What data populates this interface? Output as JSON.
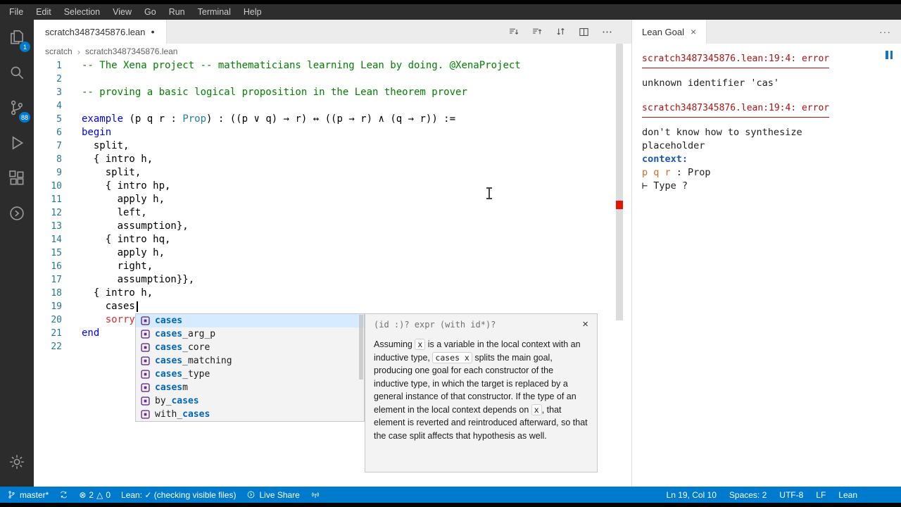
{
  "menu": {
    "items": [
      "File",
      "Edit",
      "Selection",
      "View",
      "Go",
      "Run",
      "Terminal",
      "Help"
    ]
  },
  "activity": {
    "explorer_badge": "1",
    "scm_badge": "88"
  },
  "tab": {
    "title": "scratch3487345876.lean",
    "dirty_dot": "●"
  },
  "breadcrumb": {
    "folder": "scratch",
    "sep": "›",
    "file": "scratch3487345876.lean"
  },
  "icons": {
    "close": "×",
    "more": "···"
  },
  "editor": {
    "lines": [
      {
        "num": "1",
        "text": "-- The Xena project -- mathematicians learning Lean by doing. @XenaProject"
      },
      {
        "num": "2",
        "text": ""
      },
      {
        "num": "3",
        "text": "-- proving a basic logical proposition in the Lean theorem prover"
      },
      {
        "num": "4",
        "text": ""
      },
      {
        "num": "5",
        "kw": "example",
        "mid": " (p q r : ",
        "type": "Prop",
        "rest": ") : ((p ∨ q) → r) ↔ ((p → r) ∧ (q → r)) :="
      },
      {
        "num": "6",
        "text": "begin"
      },
      {
        "num": "7",
        "text": "  split,"
      },
      {
        "num": "8",
        "text": "  { intro h,"
      },
      {
        "num": "9",
        "text": "    split,"
      },
      {
        "num": "10",
        "text": "    { intro hp,"
      },
      {
        "num": "11",
        "text": "      apply h,"
      },
      {
        "num": "12",
        "text": "      left,"
      },
      {
        "num": "13",
        "text": "      assumption},"
      },
      {
        "num": "14",
        "text": "    { intro hq,"
      },
      {
        "num": "15",
        "text": "      apply h,"
      },
      {
        "num": "16",
        "text": "      right,"
      },
      {
        "num": "17",
        "text": "      assumption}},"
      },
      {
        "num": "18",
        "text": "  { intro h,"
      },
      {
        "num": "19",
        "text": "    cases"
      },
      {
        "num": "20",
        "indent": "    ",
        "error_text": "sorry"
      },
      {
        "num": "21",
        "text": "end"
      },
      {
        "num": "22",
        "text": ""
      }
    ]
  },
  "suggest": {
    "items": [
      {
        "pre": "",
        "match": "cases",
        "post": ""
      },
      {
        "pre": "",
        "match": "cases",
        "post": "_arg_p"
      },
      {
        "pre": "",
        "match": "cases",
        "post": "_core"
      },
      {
        "pre": "",
        "match": "cases",
        "post": "_matching"
      },
      {
        "pre": "",
        "match": "cases",
        "post": "_type"
      },
      {
        "pre": "",
        "match": "cases",
        "post": "m"
      },
      {
        "pre": "by_",
        "match": "cases",
        "post": ""
      },
      {
        "pre": "with_",
        "match": "cases",
        "post": ""
      }
    ]
  },
  "docs": {
    "signature": "(id :)? expr (with id*)?",
    "p1": "Assuming ",
    "c1": "x",
    "p2": " is a variable in the local context with an inductive type, ",
    "c2": "cases x",
    "p3": " splits the main goal, producing one goal for each constructor of the inductive type, in which the target is replaced by a general instance of that constructor. If the type of an element in the local context depends on ",
    "c3": "x",
    "p4": ", that element is reverted and reintroduced afterward, so that the case split affects that hypothesis as well."
  },
  "panel": {
    "tab_title": "Lean Goal",
    "error1_location": "scratch3487345876.lean:19:4: error",
    "error1_message": "unknown identifier 'cas'",
    "error2_location": "scratch3487345876.lean:19:4: error",
    "error2_line1": "don't know how to synthesize",
    "error2_line2": "placeholder",
    "context_label": "context:",
    "hyp_names": "p q r",
    "hyp_rest": " : Prop",
    "goal": "⊢ Type ?"
  },
  "status": {
    "branch": "master*",
    "error_icon": "⊗",
    "error_count": "2",
    "warning_icon": "△",
    "warning_count": "0",
    "lean": "Lean: ✓ (checking visible files)",
    "live_share": "Live Share",
    "line_col": "Ln 19, Col 10",
    "spaces": "Spaces: 2",
    "encoding": "UTF-8",
    "eol": "LF",
    "language": "Lean"
  }
}
